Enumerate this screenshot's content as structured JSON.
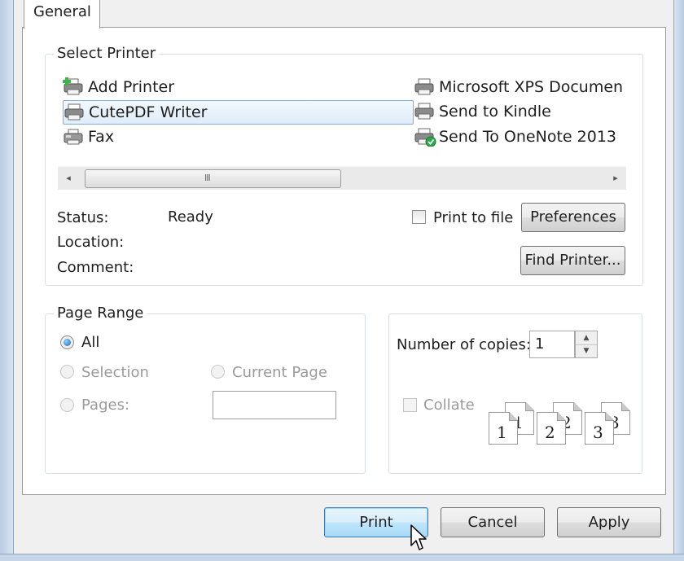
{
  "tabs": [
    {
      "label": "General"
    }
  ],
  "select_printer": {
    "legend": "Select Printer",
    "printers": [
      {
        "name": "Add Printer",
        "icon": "add-printer-icon"
      },
      {
        "name": "CutePDF Writer",
        "icon": "printer-icon",
        "selected": true
      },
      {
        "name": "Fax",
        "icon": "fax-icon"
      },
      {
        "name": "Microsoft XPS Documen",
        "icon": "printer-icon"
      },
      {
        "name": "Send to Kindle",
        "icon": "printer-icon"
      },
      {
        "name": "Send To OneNote 2013",
        "icon": "default-printer-icon"
      }
    ],
    "scroll_grip": "III",
    "status_label": "Status:",
    "status_value": "Ready",
    "location_label": "Location:",
    "comment_label": "Comment:",
    "print_to_file_label": "Print to file",
    "preferences_label": "Preferences",
    "find_printer_label": "Find Printer..."
  },
  "page_range": {
    "legend": "Page Range",
    "all_label": "All",
    "selection_label": "Selection",
    "current_page_label": "Current Page",
    "pages_label": "Pages:",
    "selected_option": "All"
  },
  "copies": {
    "number_label": "Number of copies:",
    "number_value": "1",
    "collate_label": "Collate",
    "collate_pages": [
      {
        "back": "1",
        "front": "1"
      },
      {
        "back": "2",
        "front": "2"
      },
      {
        "back": "3",
        "front": "3"
      }
    ]
  },
  "buttons": {
    "print": "Print",
    "cancel": "Cancel",
    "apply": "Apply"
  },
  "colors": {
    "selection_fill": "#deecfa",
    "selection_border": "#84acdd",
    "default_button_border": "#3c7fb1",
    "disabled_text": "#9a9a9a"
  }
}
